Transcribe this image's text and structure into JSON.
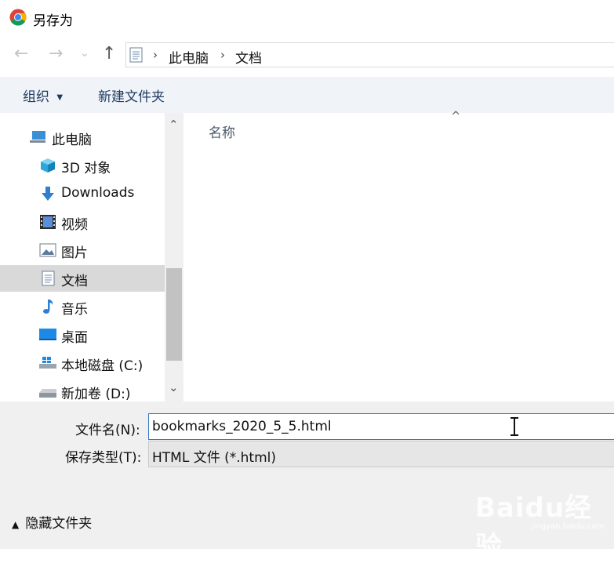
{
  "window": {
    "title": "另存为"
  },
  "address_bar": {
    "crumbs": [
      "此电脑",
      "文档"
    ]
  },
  "toolbar": {
    "organize_label": "组织",
    "new_folder_label": "新建文件夹"
  },
  "nav_pane": {
    "items": [
      {
        "label": "此电脑",
        "icon": "computer-icon"
      },
      {
        "label": "3D 对象",
        "icon": "cube-3d-icon"
      },
      {
        "label": "Downloads",
        "icon": "download-arrow-icon"
      },
      {
        "label": "视频",
        "icon": "film-icon"
      },
      {
        "label": "图片",
        "icon": "picture-icon"
      },
      {
        "label": "文档",
        "icon": "document-icon",
        "selected": true
      },
      {
        "label": "音乐",
        "icon": "music-note-icon"
      },
      {
        "label": "桌面",
        "icon": "desktop-icon"
      },
      {
        "label": "本地磁盘 (C:)",
        "icon": "windows-drive-icon"
      },
      {
        "label": "新加卷 (D:)",
        "icon": "drive-icon"
      }
    ]
  },
  "content": {
    "column_header": "名称"
  },
  "form": {
    "filename_label": "文件名(N):",
    "filename_value": "bookmarks_2020_5_5.html",
    "filetype_label": "保存类型(T):",
    "filetype_value": "HTML 文件 (*.html)"
  },
  "footer": {
    "hide_folders_label": "隐藏文件夹"
  },
  "watermark": {
    "text": "Baidu经验",
    "sub": "jingyan.baidu.com"
  },
  "colors": {
    "selected_bg": "#d9d9d9",
    "toolbar_bg": "#f0f4f9",
    "focus_border": "#3a7ac4"
  }
}
